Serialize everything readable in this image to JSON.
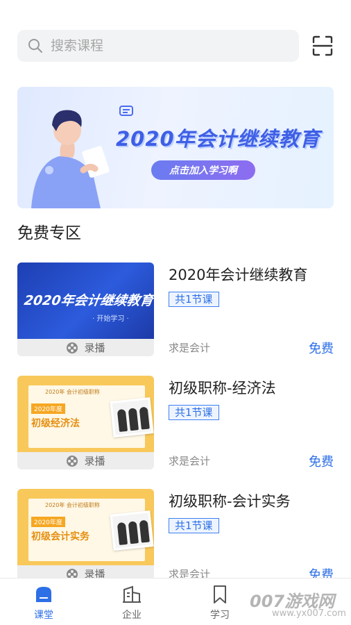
{
  "search": {
    "placeholder": "搜索课程"
  },
  "banner": {
    "title": "2020年会计继续教育",
    "button_label": "点击加入学习啊"
  },
  "section": {
    "title": "免费专区"
  },
  "courses": [
    {
      "title": "2020年会计继续教育",
      "tag": "共1节课",
      "author": "求是会计",
      "price": "免费",
      "type_label": "录播",
      "thumb_title": "2020年会计继续教育",
      "thumb_sub": "· 开始学习 ·"
    },
    {
      "title": "初级职称-经济法",
      "tag": "共1节课",
      "author": "求是会计",
      "price": "免费",
      "type_label": "录播",
      "thumb_small": "2020年 会计初级职称",
      "thumb_year": "2020年度",
      "thumb_title": "初级经济法"
    },
    {
      "title": "初级职称-会计实务",
      "tag": "共1节课",
      "author": "求是会计",
      "price": "免费",
      "type_label": "录播",
      "thumb_small": "2020年 会计初级职称",
      "thumb_year": "2020年度",
      "thumb_title": "初级会计实务"
    }
  ],
  "tabbar": {
    "items": [
      {
        "label": "课堂",
        "icon": "classroom-icon",
        "active": true
      },
      {
        "label": "企业",
        "icon": "enterprise-icon",
        "active": false
      },
      {
        "label": "学习",
        "icon": "bookmark-icon",
        "active": false
      }
    ]
  },
  "watermark": {
    "text": "007游戏网",
    "sub": "www.yx007.com"
  },
  "colors": {
    "accent": "#2c6fe6",
    "tag_bg": "#eef4ff",
    "thumb_yellow": "#f8c85a",
    "thumb_blue": "#2c5bdc"
  }
}
